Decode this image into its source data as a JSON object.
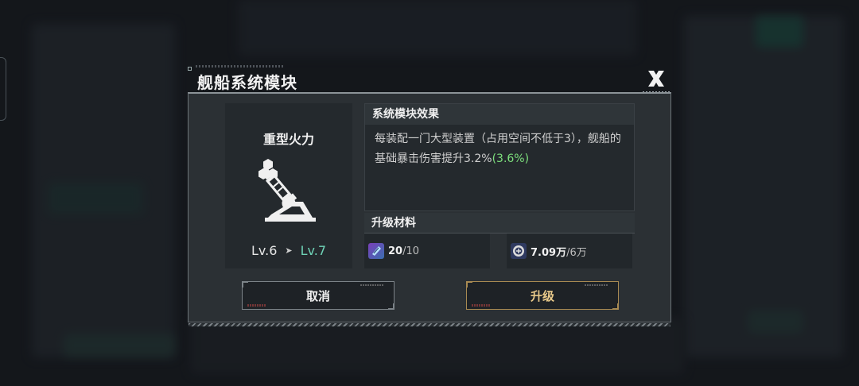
{
  "modal": {
    "title": "舰船系统模块",
    "close_icon": "close-x-icon"
  },
  "module": {
    "name": "重型火力",
    "icon": "heavy-artillery-icon",
    "level_current": "Lv.6",
    "level_next": "Lv.7"
  },
  "effect": {
    "header": "系统模块效果",
    "text": "每装配一门大型装置（占用空间不低于3），舰船的基础暴击伤害提升3.2%",
    "bonus": "(3.6%)"
  },
  "materials": {
    "header": "升级材料",
    "items": [
      {
        "icon": "module-chip-icon",
        "have": "20",
        "need": "/10"
      },
      {
        "icon": "credit-coin-icon",
        "have": "7.09万",
        "need": "/6万"
      }
    ]
  },
  "buttons": {
    "cancel": "取消",
    "upgrade": "升级"
  },
  "colors": {
    "next_level": "#6fd3b7",
    "bonus": "#7de07d",
    "upgrade_accent": "#e8c98a"
  }
}
